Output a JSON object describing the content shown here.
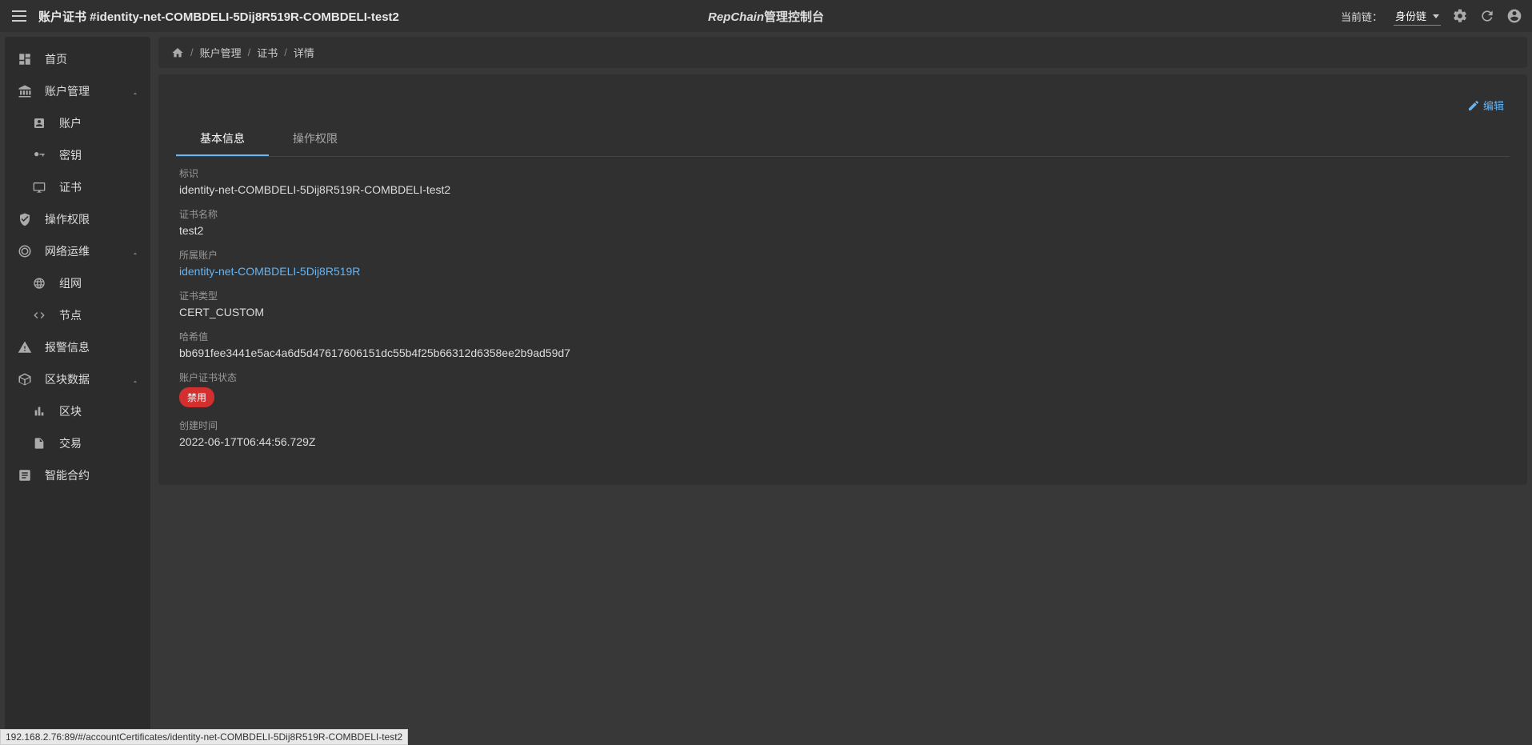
{
  "header": {
    "page_title": "账户证书 #identity-net-COMBDELI-5Dij8R519R-COMBDELI-test2",
    "brand_italic": "RepChain",
    "brand_suffix": "管理控制台",
    "current_chain_label": "当前链：",
    "current_chain_value": "身份链"
  },
  "sidebar": {
    "home": "首页",
    "account_mgmt": "账户管理",
    "account": "账户",
    "key": "密钥",
    "certificate": "证书",
    "operation_perm": "操作权限",
    "network_ops": "网络运维",
    "network": "组网",
    "node": "节点",
    "alert_info": "报警信息",
    "block_data": "区块数据",
    "block": "区块",
    "transaction": "交易",
    "smart_contract": "智能合约"
  },
  "breadcrumb": {
    "account_mgmt": "账户管理",
    "certificate": "证书",
    "detail": "详情"
  },
  "actions": {
    "edit": "编辑"
  },
  "tabs": {
    "basic_info": "基本信息",
    "operation_perm": "操作权限"
  },
  "fields": {
    "identifier_label": "标识",
    "identifier_value": "identity-net-COMBDELI-5Dij8R519R-COMBDELI-test2",
    "cert_name_label": "证书名称",
    "cert_name_value": "test2",
    "owner_account_label": "所属账户",
    "owner_account_value": "identity-net-COMBDELI-5Dij8R519R",
    "cert_type_label": "证书类型",
    "cert_type_value": "CERT_CUSTOM",
    "hash_label": "哈希值",
    "hash_value": "bb691fee3441e5ac4a6d5d47617606151dc55b4f25b66312d6358ee2b9ad59d7",
    "status_label": "账户证书状态",
    "status_value": "禁用",
    "create_time_label": "创建时间",
    "create_time_value": "2022-06-17T06:44:56.729Z"
  },
  "statusbar": "192.168.2.76:89/#/accountCertificates/identity-net-COMBDELI-5Dij8R519R-COMBDELI-test2"
}
